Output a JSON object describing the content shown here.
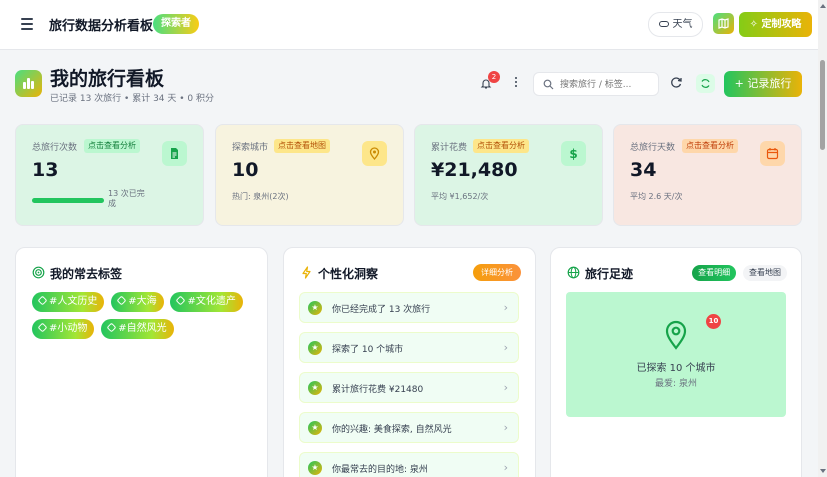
{
  "topbar": {
    "title": "旅行数据分析看板",
    "badge": "探索者",
    "weather_label": "天气",
    "custom_label": "定制攻略"
  },
  "header": {
    "title": "我的旅行看板",
    "subtitle": "已记录 13 次旅行 • 累计 34 天 • 0 积分",
    "notification_count": "2",
    "search_placeholder": "搜索旅行 / 标签...",
    "record_label": "+ 记录旅行"
  },
  "stats": [
    {
      "label": "总旅行次数",
      "tag": "点击查看分析",
      "value": "13",
      "progress_label": "13 次已完成",
      "progress_fraction": 1.0,
      "icon": "document-icon",
      "color": "#22c55e"
    },
    {
      "label": "探索城市",
      "tag": "点击查看地图",
      "value": "10",
      "sub": "热门: 泉州(2次)",
      "icon": "location-icon",
      "color": "#eab308"
    },
    {
      "label": "累计花费",
      "tag": "点击查看分析",
      "value": "¥21,480",
      "sub": "平均 ¥1,652/次",
      "icon": "dollar-icon",
      "color": "#22c55e"
    },
    {
      "label": "总旅行天数",
      "tag": "点击查看分析",
      "value": "34",
      "sub": "平均 2.6 天/次",
      "icon": "calendar-icon",
      "color": "#f97316"
    }
  ],
  "tags_panel": {
    "title": "我的常去标签",
    "tags": [
      "#人文历史",
      "#大海",
      "#文化遗产",
      "#小动物",
      "#自然风光"
    ]
  },
  "insights_panel": {
    "title": "个性化洞察",
    "badge": "详细分析",
    "items": [
      "你已经完成了 13 次旅行",
      "探索了 10 个城市",
      "累计旅行花费 ¥21480",
      "你的兴趣: 美食探索, 自然风光",
      "你最常去的目的地: 泉州"
    ]
  },
  "map_panel": {
    "title": "旅行足迹",
    "tab_active": "查看明细",
    "tab_inactive": "查看地图",
    "pin_count": "10",
    "line1": "已探索 10 个城市",
    "line2": "最爱: 泉州"
  }
}
